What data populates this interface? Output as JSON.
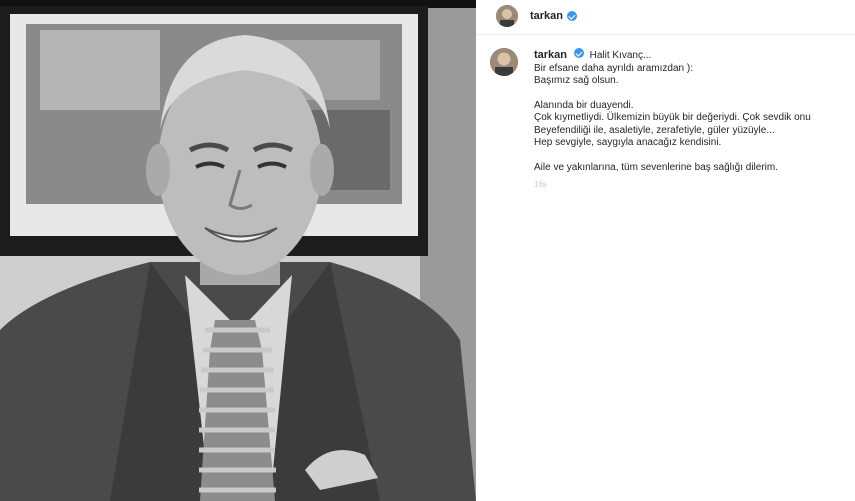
{
  "post": {
    "username": "tarkan",
    "verified": true
  },
  "caption": {
    "username": "tarkan",
    "mention": "Halit Kıvanç...",
    "lines": [
      "Bir efsane daha ayrıldı aramızdan ):",
      "Başımız sağ olsun.",
      "",
      "Alanında bir duayendi.",
      "Çok kıymetliydi. Ülkemizin büyük bir değeriydi. Çok sevdik onu",
      "Beyefendiliği ile, asaletiyle, zerafetiyle, güler yüzüyle...",
      "Hep sevgiyle, saygıyla anacağız kendisini.",
      "",
      "Aile ve yakınlarına, tüm sevenlerine baş sağlığı dilerim."
    ],
    "time": "16s"
  },
  "colors": {
    "verified_badge": "#3897f0",
    "text": "#262626",
    "muted": "#c7c7c7"
  }
}
